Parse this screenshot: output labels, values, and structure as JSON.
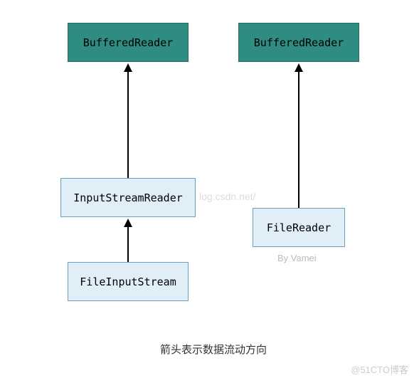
{
  "left_column": {
    "top_box": "BufferedReader",
    "middle_box": "InputStreamReader",
    "bottom_box": "FileInputStream"
  },
  "right_column": {
    "top_box": "BufferedReader",
    "bottom_box": "FileReader"
  },
  "caption": "箭头表示数据流动方向",
  "watermark_center": "log.csdn.net/",
  "watermark_by": "By Vamei",
  "watermark_footer": "@51CTO博客"
}
